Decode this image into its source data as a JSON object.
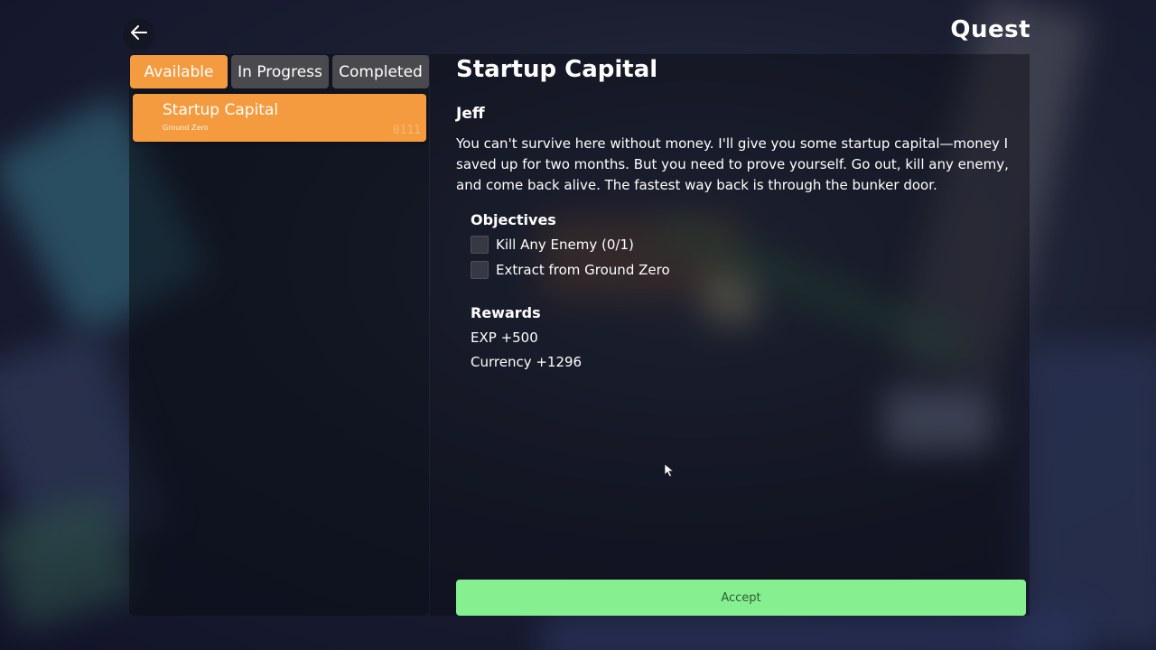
{
  "header": {
    "title": "Quest",
    "back_icon": "arrow-left-icon"
  },
  "tabs": [
    {
      "label": "Available",
      "active": true
    },
    {
      "label": "In Progress",
      "active": false
    },
    {
      "label": "Completed",
      "active": false
    }
  ],
  "quest_list": [
    {
      "name": "Startup Capital",
      "location": "Ground Zero",
      "id": "0111",
      "selected": true
    }
  ],
  "detail": {
    "title": "Startup Capital",
    "giver": "Jeff",
    "description": "You can't survive here without money. I'll give you some startup capital—money I saved up for two months. But you need to prove yourself. Go out, kill any enemy, and come back alive. The fastest way back is through the bunker door.",
    "objectives_title": "Objectives",
    "objectives": [
      {
        "text": "Kill Any Enemy (0/1)",
        "done": false
      },
      {
        "text": "Extract from Ground Zero",
        "done": false
      }
    ],
    "rewards_title": "Rewards",
    "rewards": [
      "EXP +500",
      "Currency +1296"
    ],
    "accept_label": "Accept"
  },
  "colors": {
    "accent_orange": "#f49b3f",
    "tab_inactive": "#4a4a4e",
    "accept_green": "#86ef8f",
    "accept_text": "#2f5c36"
  }
}
